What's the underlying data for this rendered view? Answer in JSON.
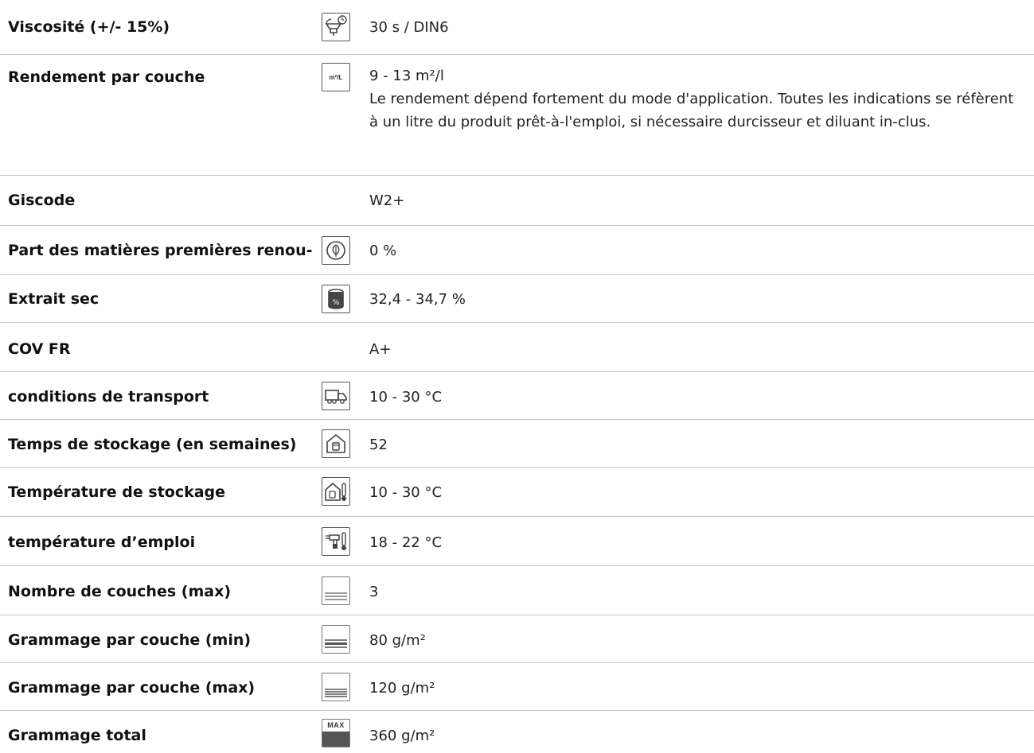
{
  "rows": [
    {
      "label": "Viscosité (+/- 15%)",
      "icon": "viscosity-cup-timer-icon",
      "value": "30 s / DIN6"
    },
    {
      "label": "Rendement par couche",
      "icon": "coverage-m2-per-liter-icon",
      "icon_text": "m²/L",
      "value": "9 - 13 m²/l",
      "note": "Le rendement dépend fortement du mode d'application. Toutes les indications se réfèrent à un litre du produit prêt-à-l'emploi, si nécessaire durcisseur et diluant in-clus."
    },
    {
      "label": "Giscode",
      "icon": "",
      "value": "W2+"
    },
    {
      "label": "Part des matières premières renou-",
      "icon": "renewable-leaf-icon",
      "value": "0 %"
    },
    {
      "label": "Extrait sec",
      "icon": "solid-content-can-icon",
      "value": "32,4 - 34,7 %"
    },
    {
      "label": "COV FR",
      "icon": "",
      "value": "A+"
    },
    {
      "label": "conditions de transport",
      "icon": "delivery-truck-icon",
      "value": "10 - 30 °C"
    },
    {
      "label": "Temps de stockage (en semaines)",
      "icon": "storage-house-icon",
      "value": "52"
    },
    {
      "label": "Température de stockage",
      "icon": "storage-temperature-icon",
      "value": "10 - 30 °C"
    },
    {
      "label": "température d’emploi",
      "icon": "spray-gun-thermometer-icon",
      "value": "18 - 22 °C"
    },
    {
      "label": "Nombre de couches (max)",
      "icon": "layers-count-icon",
      "value": "3"
    },
    {
      "label": "Grammage par couche (min)",
      "icon": "layer-weight-min-icon",
      "value": "80 g/m²"
    },
    {
      "label": "Grammage par couche (max)",
      "icon": "layer-weight-max-icon",
      "value": "120 g/m²"
    },
    {
      "label": "Grammage total",
      "icon": "total-weight-max-icon",
      "icon_text": "MAX",
      "value": "360 g/m²"
    }
  ]
}
